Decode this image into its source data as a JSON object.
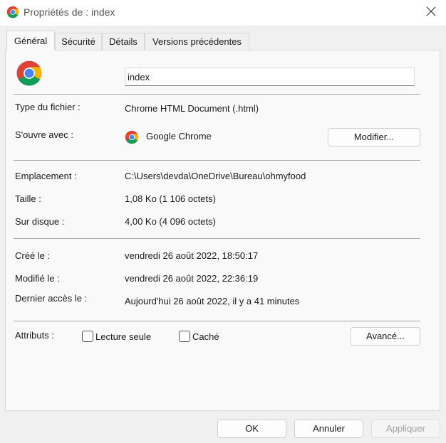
{
  "window": {
    "title": "Propriétés de : index"
  },
  "tabs": [
    {
      "label": "Général"
    },
    {
      "label": "Sécurité"
    },
    {
      "label": "Détails"
    },
    {
      "label": "Versions précédentes"
    }
  ],
  "file": {
    "name": "index",
    "type_label": "Type du fichier :",
    "type_value": "Chrome HTML Document (.html)",
    "opens_label": "S'ouvre avec :",
    "opens_value": "Google Chrome",
    "change_button": "Modifier...",
    "location_label": "Emplacement :",
    "location_value": "C:\\Users\\devda\\OneDrive\\Bureau\\ohmyfood",
    "size_label": "Taille :",
    "size_value": "1,08 Ko (1 106 octets)",
    "disk_label": "Sur disque :",
    "disk_value": "4,00 Ko (4 096 octets)",
    "created_label": "Créé le :",
    "created_value": "vendredi 26 août 2022, 18:50:17",
    "modified_label": "Modifié le :",
    "modified_value": "vendredi 26 août 2022, 22:36:19",
    "accessed_label": "Dernier accès le :",
    "accessed_value": "Aujourd'hui 26 août 2022, il y a 41 minutes",
    "attributes_label": "Attributs :",
    "readonly_label": "Lecture seule",
    "readonly_checked": false,
    "hidden_label": "Caché",
    "hidden_checked": false,
    "advanced_button": "Avancé..."
  },
  "footer": {
    "ok": "OK",
    "cancel": "Annuler",
    "apply": "Appliquer"
  },
  "icons": {
    "title": "chrome-icon",
    "close": "close-icon",
    "file": "chrome-icon",
    "app": "chrome-icon"
  },
  "colors": {
    "chrome_red": "#db4437",
    "chrome_green": "#0f9d58",
    "chrome_yellow": "#f4b400",
    "chrome_blue": "#4285f4"
  }
}
